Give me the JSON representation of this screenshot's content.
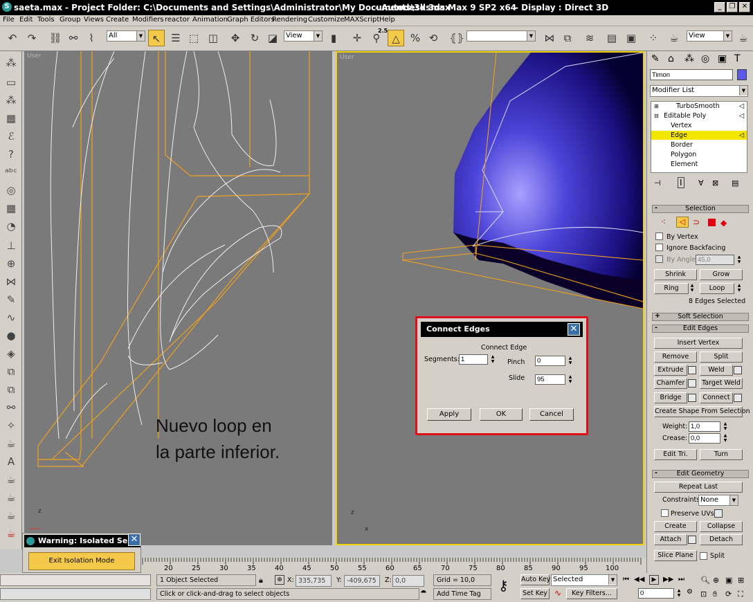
{
  "window": {
    "file_title": "saeta.max",
    "folder_title": "- Project Folder: C:\\Documents and Settings\\Administrator\\My Documents\\3dsmax",
    "app_title": "- Autodesk 3ds Max 9 SP2 x64",
    "display_title": "- Display : Direct 3D"
  },
  "menu": [
    "File",
    "Edit",
    "Tools",
    "Group",
    "Views",
    "Create",
    "Modifiers",
    "reactor",
    "Animation",
    "Graph Editors",
    "Rendering",
    "Customize",
    "MAXScript",
    "Help"
  ],
  "toolbar": {
    "selection_filter": "All",
    "ref_coord": "View",
    "snap_value": "2.5",
    "named_selection": "",
    "right_dropdown": "View"
  },
  "viewports": {
    "left_label": "User",
    "right_label": "User",
    "annotation_line1": "Nuevo loop en",
    "annotation_line2": "la parte inferior.",
    "axis_z": "z",
    "axis_x": "x"
  },
  "command_panel": {
    "object_name": "Timon",
    "object_color": "#5b5bea",
    "modifier_list": "Modifier List",
    "stack": [
      {
        "label": "TurboSmooth",
        "level": 0
      },
      {
        "label": "Editable Poly",
        "level": 0
      },
      {
        "label": "Vertex",
        "level": 1
      },
      {
        "label": "Edge",
        "level": 1
      },
      {
        "label": "Border",
        "level": 1
      },
      {
        "label": "Polygon",
        "level": 1
      },
      {
        "label": "Element",
        "level": 1
      }
    ],
    "selection": {
      "title": "Selection",
      "by_vertex": "By Vertex",
      "ignore_backfacing": "Ignore Backfacing",
      "by_angle": "By Angle:",
      "angle_value": "45,0",
      "shrink": "Shrink",
      "grow": "Grow",
      "ring": "Ring",
      "loop": "Loop",
      "status": "8 Edges Selected"
    },
    "soft_selection": "Soft Selection",
    "edit_edges": {
      "title": "Edit Edges",
      "insert_vertex": "Insert Vertex",
      "remove": "Remove",
      "split": "Split",
      "extrude": "Extrude",
      "weld": "Weld",
      "chamfer": "Chamfer",
      "target_weld": "Target Weld",
      "bridge": "Bridge",
      "connect": "Connect",
      "create_shape": "Create Shape From Selection",
      "weight_label": "Weight:",
      "weight_value": "1,0",
      "crease_label": "Crease:",
      "crease_value": "0,0",
      "edit_tri": "Edit Tri.",
      "turn": "Turn"
    },
    "edit_geometry": {
      "title": "Edit Geometry",
      "repeat_last": "Repeat Last",
      "constraints_label": "Constraints:",
      "constraints_value": "None",
      "preserve_uvs": "Preserve UVs",
      "create": "Create",
      "collapse": "Collapse",
      "attach": "Attach",
      "detach": "Detach",
      "slice_plane": "Slice Plane",
      "split": "Split"
    }
  },
  "dialog": {
    "title": "Connect Edges",
    "group": "Connect Edge",
    "segments_label": "Segments:",
    "segments_value": "1",
    "pinch_label": "Pinch",
    "pinch_value": "0",
    "slide_label": "Slide",
    "slide_value": "95",
    "apply": "Apply",
    "ok": "OK",
    "cancel": "Cancel"
  },
  "isolation": {
    "title": "Warning: Isolated Sel...",
    "button": "Exit Isolation Mode"
  },
  "timeline": {
    "ticks": [
      "20",
      "25",
      "30",
      "35",
      "40",
      "45",
      "50",
      "55",
      "60",
      "65",
      "70",
      "75",
      "80",
      "85",
      "90",
      "95",
      "100"
    ]
  },
  "status": {
    "selected": "1 Object Selected",
    "prompt": "Click or click-and-drag to select objects",
    "x_label": "X:",
    "x_value": "335,735",
    "y_label": "Y:",
    "y_value": "-409,675",
    "z_label": "Z:",
    "z_value": "0,0",
    "grid": "Grid = 10,0",
    "add_time_tag": "Add Time Tag",
    "auto_key": "Auto Key",
    "set_key": "Set Key",
    "key_mode": "Selected",
    "key_filters": "Key Filters...",
    "frame": "0"
  }
}
